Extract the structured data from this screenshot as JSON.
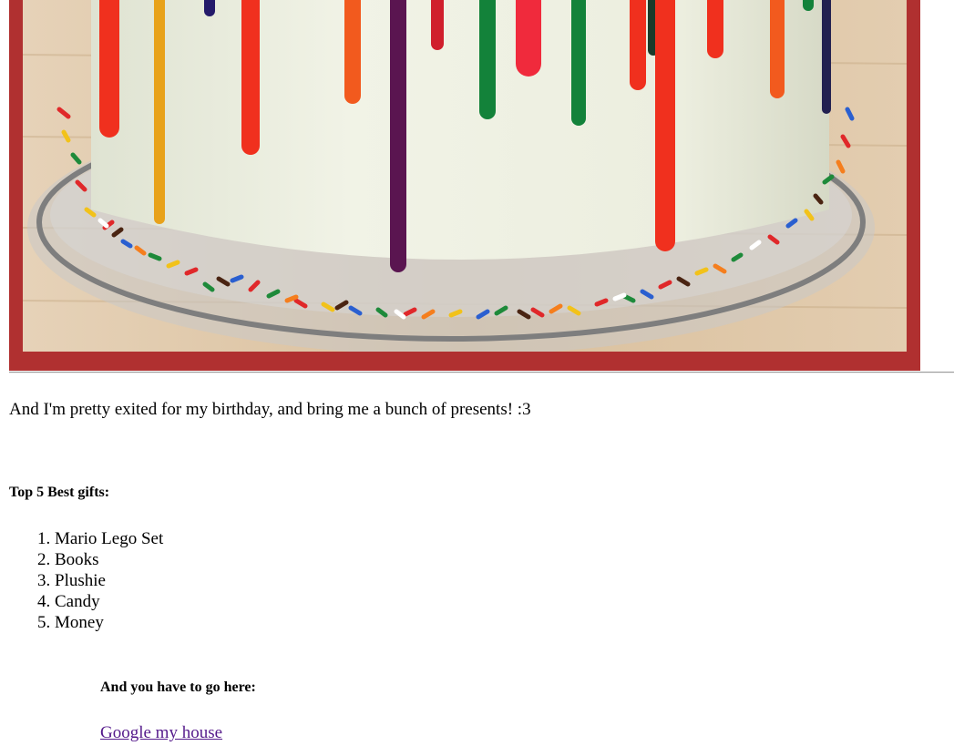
{
  "photo": {
    "frame_color": "#b03030",
    "frosting_color": "#ecefe0",
    "plate_color": "#8e8e8e",
    "board_color": "#dcc4a6"
  },
  "intro": {
    "text": "And I'm pretty exited for my birthday, and bring me a bunch of presents! :3"
  },
  "gifts": {
    "heading": "Top 5 Best gifts:",
    "items": [
      "Mario Lego Set",
      "Books",
      "Plushie",
      "Candy",
      "Money"
    ]
  },
  "directions": {
    "heading": "And you have to go here:",
    "link_text": "Google my house",
    "link_color": "#551a8b"
  }
}
